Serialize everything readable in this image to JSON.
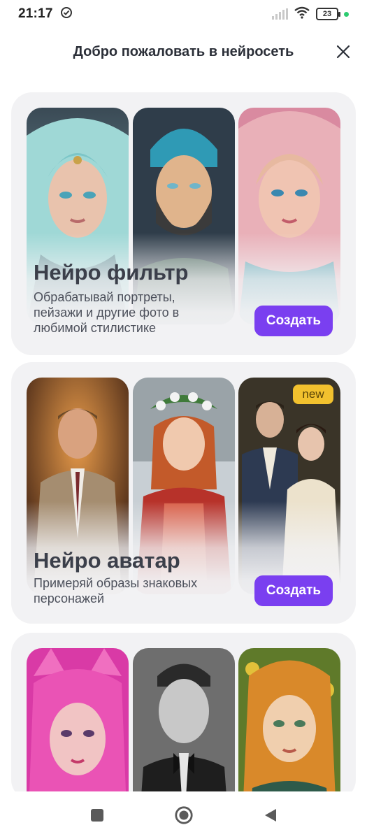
{
  "status_bar": {
    "time": "21:17",
    "battery": "23",
    "icons": [
      "check-circle-icon",
      "signal-icon",
      "wifi-icon",
      "battery-icon"
    ],
    "dot_color": "#2ecc71"
  },
  "header": {
    "title": "Добро пожаловать в нейросеть",
    "close_icon": "close-icon"
  },
  "cards": [
    {
      "title": "Нейро фильтр",
      "description": "Обрабатывай портреты, пейзажи и другие фото в любимой стилистике",
      "button_label": "Создать",
      "images": [
        "portrait-teal-hair-girl",
        "portrait-cartoon-bearded-man",
        "portrait-pink-hair-girl"
      ]
    },
    {
      "title": "Нейро аватар",
      "description": "Примеряй образы знаковых персонажей",
      "button_label": "Создать",
      "badge": "new",
      "images": [
        "portrait-man-in-suit",
        "portrait-girl-flower-wreath",
        "portrait-victorian-couple"
      ]
    },
    {
      "title": "",
      "images": [
        "portrait-pink-hair-cat-ears",
        "portrait-bw-man-bowtie",
        "portrait-ginger-girl-painting"
      ]
    }
  ],
  "nav_bar": {
    "icons": [
      "recent-apps-icon",
      "home-icon",
      "back-icon"
    ]
  },
  "colors": {
    "accent": "#7a3ff0",
    "card_bg": "#f2f2f4",
    "badge": "#f2c12e"
  }
}
